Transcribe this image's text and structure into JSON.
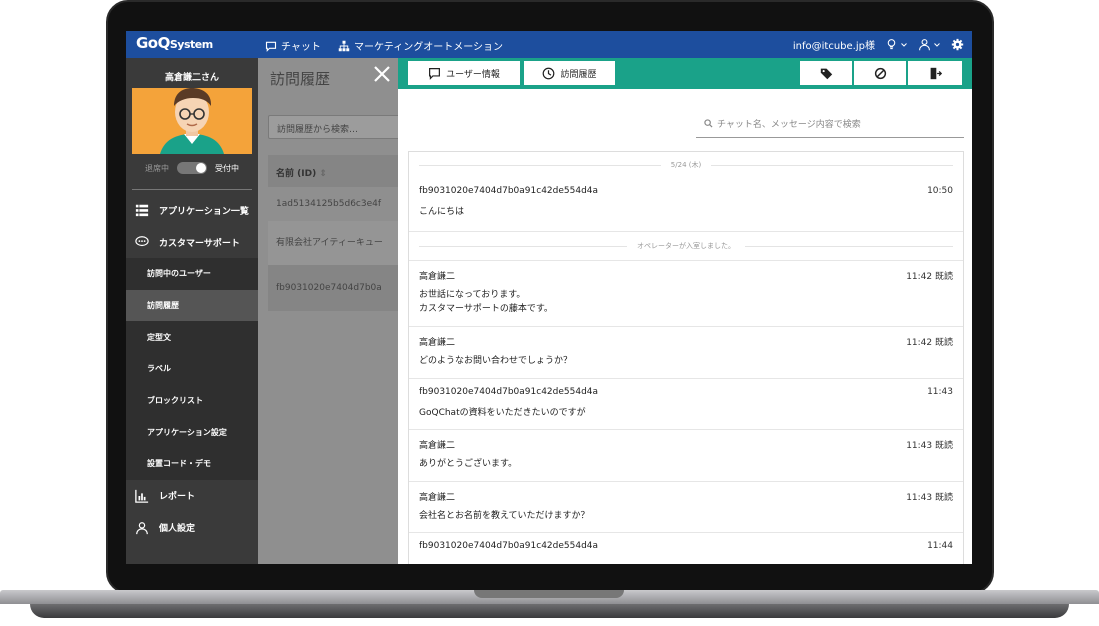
{
  "header": {
    "logo_main": "GoQ",
    "logo_sub": "System",
    "nav": [
      {
        "label": "チャット",
        "icon": "chat-icon"
      },
      {
        "label": "マーケティングオートメーション",
        "icon": "org-chart-icon"
      }
    ],
    "email": "info@itcube.jp様",
    "colors": {
      "header": "#1d4e9e",
      "accent": "#1aa289"
    }
  },
  "sidebar": {
    "user_name": "高倉謙二さん",
    "status_away": "退席中",
    "status_active": "受付中",
    "menu": [
      {
        "label": "アプリケーション一覧",
        "icon": "list-icon"
      },
      {
        "label": "カスタマーサポート",
        "icon": "chat-bubble-icon"
      }
    ],
    "submenu": [
      {
        "label": "訪問中のユーザー"
      },
      {
        "label": "訪問履歴",
        "active": true
      },
      {
        "label": "定型文"
      },
      {
        "label": "ラベル"
      },
      {
        "label": "ブロックリスト"
      },
      {
        "label": "アプリケーション設定"
      },
      {
        "label": "設置コード・デモ"
      }
    ],
    "menu_bottom": [
      {
        "label": "レポート",
        "icon": "bar-chart-icon"
      },
      {
        "label": "個人設定",
        "icon": "user-icon"
      }
    ]
  },
  "history": {
    "title": "訪問履歴",
    "search_placeholder": "訪問履歴から検索…",
    "column_name": "名前 (ID)",
    "rows": [
      "1ad5134125b5d6c3e4f",
      "有限会社アイティーキュー",
      "fb9031020e7404d7b0a"
    ]
  },
  "detail": {
    "tab_user_info": "ユーザー情報",
    "tab_visit_history": "訪問履歴",
    "search_placeholder": "チャット名、メッセージ内容で検索",
    "date_divider": "5/24 (木)",
    "operator_joined": "オペレーターが入室しました。",
    "messages": [
      {
        "sender": "fb9031020e7404d7b0a91c42de554d4a",
        "time": "10:50",
        "lines": [
          "こんにちは"
        ]
      },
      {
        "sender": "高倉謙二",
        "time": "11:42 既読",
        "lines": [
          "お世話になっております。",
          "カスタマーサポートの藤本です。"
        ]
      },
      {
        "sender": "高倉謙二",
        "time": "11:42 既読",
        "lines": [
          "どのようなお問い合わせでしょうか？"
        ]
      },
      {
        "sender": "fb9031020e7404d7b0a91c42de554d4a",
        "time": "11:43",
        "lines": [
          "GoQChatの資料をいただきたいのですが"
        ]
      },
      {
        "sender": "高倉謙二",
        "time": "11:43 既読",
        "lines": [
          "ありがとうございます。"
        ]
      },
      {
        "sender": "高倉謙二",
        "time": "11:43 既読",
        "lines": [
          "会社名とお名前を教えていただけますか？"
        ]
      },
      {
        "sender": "fb9031020e7404d7b0a91c42de554d4a",
        "time": "11:44",
        "lines": [
          ""
        ]
      }
    ]
  }
}
